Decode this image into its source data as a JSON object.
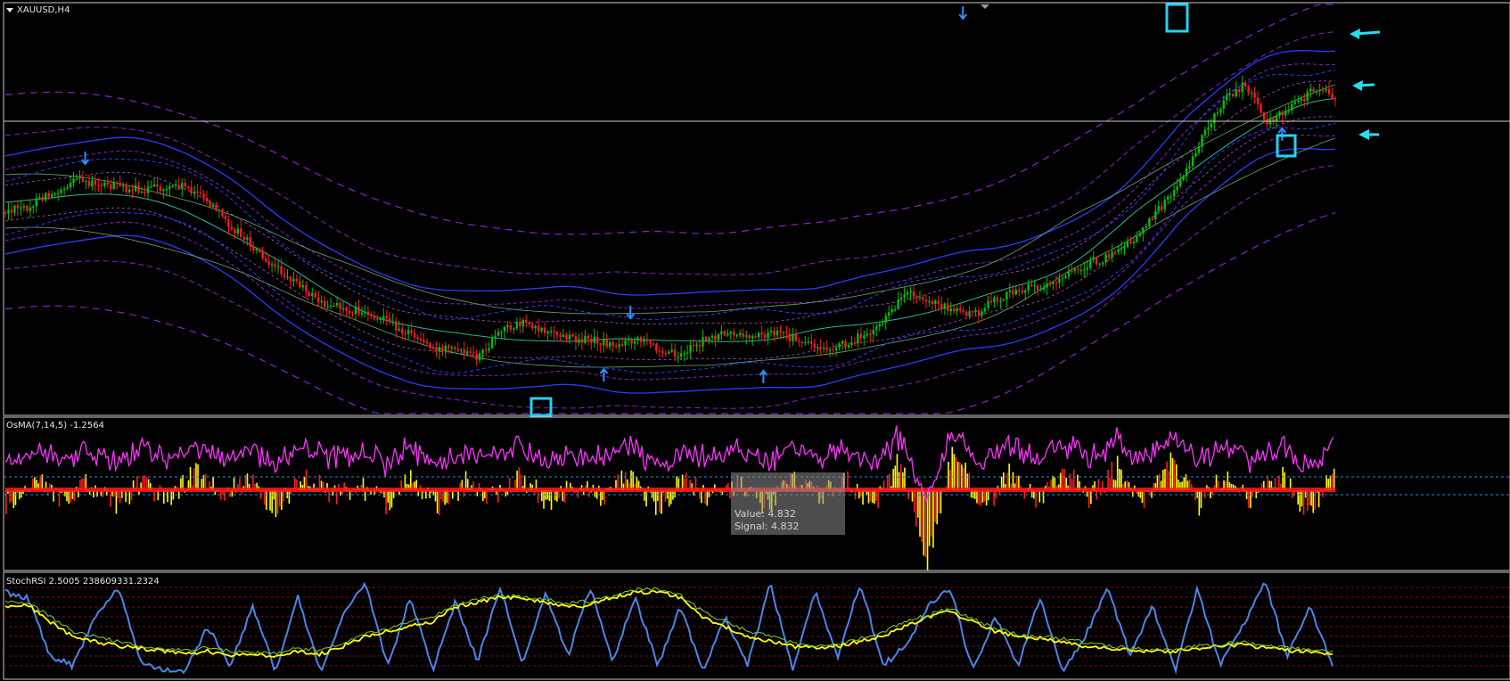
{
  "window": {
    "title": "XAUUSD,H4",
    "menu_arrow": "triangle-down-icon"
  },
  "colors": {
    "background": "#000000",
    "frame": "#c8c8c8",
    "bull_candle": "#00c000",
    "bear_candle": "#ff1a1a",
    "band_blue": "#2a3cff",
    "band_purple": "#8a1fc9",
    "band_teal": "#2bb5a0",
    "band_green": "#6aa86a",
    "band_pink_dashed": "#b04fd1",
    "signal_arrow": "#2f8fff",
    "highlight_box": "#21d4f0",
    "annotation_arrow": "#21e0f0",
    "osma_up": "#ffff00",
    "osma_down": "#ff1a1a",
    "osma_line": "#ff33ff",
    "stoch_blue": "#4a86e8",
    "stoch_yellow": "#ffff00",
    "stoch_green": "#7cd33c",
    "level_red_dashed": "#b01010",
    "level_blue_dashed": "#2a8ad8"
  },
  "panels": {
    "price": {
      "label": "XAUUSD,H4"
    },
    "osma": {
      "label": "OsMA(7,14,5) -1.2564"
    },
    "stoch": {
      "label": "StochRSI 2.5005 238609331.2324"
    }
  },
  "tooltip": {
    "line1": "Value: 4.832",
    "line2": "Signal: 4.832"
  },
  "chart_data": [
    {
      "type": "line",
      "title": "XAUUSD,H4",
      "x": [
        1,
        2,
        3,
        4,
        5,
        6,
        7,
        8,
        9,
        10,
        11,
        12,
        13,
        14,
        15,
        16,
        17,
        18,
        19,
        20,
        21,
        22,
        23,
        24,
        25,
        26,
        27,
        28,
        29,
        30,
        31,
        32,
        33,
        34,
        35,
        36,
        37,
        38,
        39,
        40,
        41,
        42,
        43,
        44,
        45,
        46,
        47,
        48,
        49,
        50,
        51,
        52,
        53,
        54,
        55,
        56,
        57,
        58,
        59,
        60
      ],
      "series": [
        {
          "values": [
            238,
            232,
            218,
            203,
            205,
            209,
            213,
            211,
            207,
            228,
            253,
            277,
            300,
            318,
            340,
            346,
            350,
            362,
            376,
            390,
            395,
            402,
            371,
            360,
            372,
            380,
            381,
            387,
            383,
            390,
            398,
            381,
            372,
            378,
            374,
            379,
            388,
            388,
            377,
            360,
            326,
            335,
            347,
            352,
            336,
            326,
            320,
            310,
            296,
            287,
            272,
            240,
            210,
            158,
            115,
            95,
            137,
            122,
            100,
            108
          ]
        }
      ],
      "signals_down": [
        [
          6,
          178
        ],
        [
          47,
          351
        ],
        [
          72,
          15
        ]
      ],
      "signals_up": [
        [
          45,
          420
        ],
        [
          57,
          422
        ],
        [
          96,
          150
        ]
      ],
      "grid": false
    },
    {
      "type": "bar",
      "title": "OsMA(7,14,5) -1.2564",
      "values": [
        -0.6,
        0.5,
        -0.4,
        0.3,
        -0.5,
        0.2,
        -0.3,
        0.6,
        -0.2,
        0.4,
        -0.8,
        0.7,
        -0.3,
        0.2,
        -0.5,
        0.4,
        -0.6,
        0.3,
        -0.2,
        0.5,
        -0.4,
        0.2,
        -0.3,
        0.6,
        -0.7,
        0.4,
        -0.3,
        0.2,
        -0.5,
        0.3,
        -0.2,
        0.4,
        -0.6,
        1.2,
        -2.8,
        1.8,
        -0.9,
        0.6,
        -0.4,
        0.8,
        -0.3,
        0.9,
        -0.5,
        1.1,
        -0.6,
        0.7,
        -0.4,
        0.6,
        -0.8,
        0.5
      ],
      "ylim": [
        -3,
        3
      ],
      "levels": [
        0.5,
        -0.5
      ]
    },
    {
      "type": "line",
      "title": "StochRSI 2.5005 238609331.2324",
      "ylim": [
        0,
        100
      ],
      "levels": [
        10,
        20,
        30,
        40,
        50,
        60,
        70,
        80,
        90
      ],
      "series": [
        {
          "values": [
            85,
            80,
            20,
            10,
            60,
            90,
            15,
            5,
            5,
            50,
            10,
            70,
            5,
            80,
            5,
            60,
            95,
            10,
            80,
            5,
            75,
            15,
            90,
            10,
            85,
            20,
            90,
            15,
            80,
            10,
            70,
            5,
            60,
            10,
            95,
            5,
            85,
            20,
            95,
            10,
            30,
            70,
            90,
            5,
            60,
            10,
            80,
            5,
            40,
            90,
            20,
            70,
            5,
            90,
            10,
            50,
            95,
            20,
            70,
            10
          ]
        },
        {
          "values": [
            70,
            72,
            55,
            40,
            35,
            30,
            28,
            25,
            22,
            25,
            20,
            22,
            20,
            25,
            22,
            30,
            40,
            45,
            50,
            55,
            70,
            75,
            80,
            78,
            75,
            70,
            72,
            80,
            85,
            86,
            80,
            60,
            50,
            40,
            35,
            30,
            28,
            30,
            35,
            40,
            50,
            60,
            65,
            55,
            45,
            40,
            38,
            35,
            30,
            28,
            26,
            24,
            25,
            28,
            30,
            32,
            28,
            26,
            24,
            22
          ]
        },
        {
          "values": [
            75,
            74,
            60,
            45,
            40,
            35,
            30,
            28,
            26,
            28,
            25,
            24,
            22,
            28,
            26,
            32,
            42,
            48,
            55,
            60,
            72,
            78,
            82,
            80,
            78,
            74,
            76,
            82,
            88,
            88,
            82,
            65,
            55,
            45,
            40,
            34,
            30,
            32,
            38,
            44,
            55,
            62,
            68,
            58,
            48,
            42,
            40,
            38,
            34,
            30,
            28,
            26,
            27,
            30,
            32,
            34,
            30,
            28,
            26,
            24
          ]
        }
      ]
    }
  ]
}
